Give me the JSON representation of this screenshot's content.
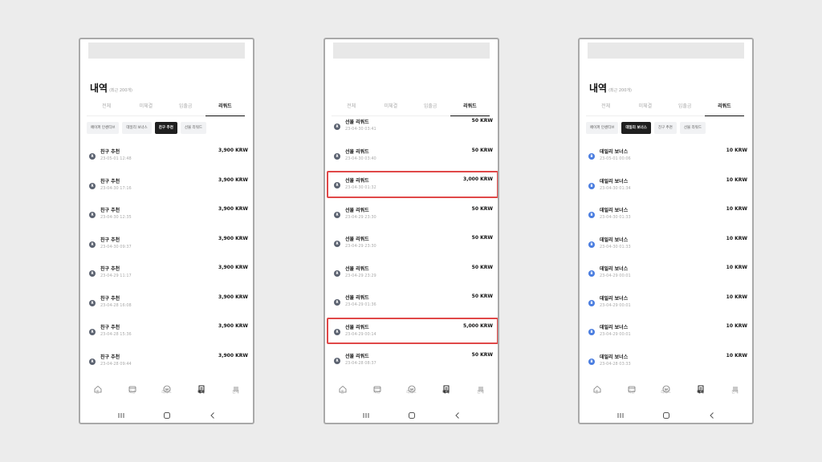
{
  "screens": [
    {
      "title": "내역",
      "subtitle": "(최근 200개)",
      "tabs": [
        "전체",
        "미체결",
        "입출금",
        "리워드"
      ],
      "active_tab": 3,
      "chips": [
        "페이퍼 인센티브",
        "데일리 보너스",
        "친구 추천",
        "선물 리워드"
      ],
      "active_chip": 2,
      "rows": [
        {
          "icon": "R",
          "title": "친구 추천",
          "time": "23-05-01 12:48",
          "amount": "3,900 KRW"
        },
        {
          "icon": "R",
          "title": "친구 추천",
          "time": "23-04-30 17:16",
          "amount": "3,900 KRW"
        },
        {
          "icon": "R",
          "title": "친구 추천",
          "time": "23-04-30 12:35",
          "amount": "3,900 KRW"
        },
        {
          "icon": "R",
          "title": "친구 추천",
          "time": "23-04-30 09:37",
          "amount": "3,900 KRW"
        },
        {
          "icon": "R",
          "title": "친구 추천",
          "time": "23-04-29 11:17",
          "amount": "3,900 KRW"
        },
        {
          "icon": "R",
          "title": "친구 추천",
          "time": "23-04-28 16:08",
          "amount": "3,900 KRW"
        },
        {
          "icon": "R",
          "title": "친구 추천",
          "time": "23-04-28 15:36",
          "amount": "3,900 KRW"
        },
        {
          "icon": "R",
          "title": "친구 추천",
          "time": "23-04-28 09:44",
          "amount": "3,900 KRW"
        }
      ]
    },
    {
      "tabs": [
        "전체",
        "미체결",
        "입출금",
        "리워드"
      ],
      "active_tab": 3,
      "rows": [
        {
          "icon": "R",
          "title": "선물 리워드",
          "time": "23-04-30 03:41",
          "amount": "50 KRW"
        },
        {
          "icon": "R",
          "title": "선물 리워드",
          "time": "23-04-30 03:40",
          "amount": "50 KRW"
        },
        {
          "icon": "R",
          "title": "선물 리워드",
          "time": "23-04-30 01:32",
          "amount": "3,000 KRW",
          "highlight": true
        },
        {
          "icon": "R",
          "title": "선물 리워드",
          "time": "23-04-29 23:30",
          "amount": "50 KRW"
        },
        {
          "icon": "R",
          "title": "선물 리워드",
          "time": "23-04-29 23:30",
          "amount": "50 KRW"
        },
        {
          "icon": "R",
          "title": "선물 리워드",
          "time": "23-04-29 23:29",
          "amount": "50 KRW"
        },
        {
          "icon": "R",
          "title": "선물 리워드",
          "time": "23-04-29 01:36",
          "amount": "50 KRW"
        },
        {
          "icon": "R",
          "title": "선물 리워드",
          "time": "23-04-29 00:14",
          "amount": "5,000 KRW",
          "highlight": true
        },
        {
          "icon": "R",
          "title": "선물 리워드",
          "time": "23-04-28 08:37",
          "amount": "50 KRW"
        }
      ]
    },
    {
      "title": "내역",
      "subtitle": "(최근 200개)",
      "tabs": [
        "전체",
        "미체결",
        "입출금",
        "리워드"
      ],
      "active_tab": 3,
      "chips": [
        "페이퍼 인센티브",
        "데일리 보너스",
        "친구 추천",
        "선물 리워드"
      ],
      "active_chip": 1,
      "rows": [
        {
          "icon": "B",
          "title": "데일리 보너스",
          "time": "23-05-01 00:06",
          "amount": "10 KRW"
        },
        {
          "icon": "B",
          "title": "데일리 보너스",
          "time": "23-04-30 01:34",
          "amount": "10 KRW"
        },
        {
          "icon": "B",
          "title": "데일리 보너스",
          "time": "23-04-30 01:33",
          "amount": "10 KRW"
        },
        {
          "icon": "B",
          "title": "데일리 보너스",
          "time": "23-04-30 01:33",
          "amount": "10 KRW"
        },
        {
          "icon": "B",
          "title": "데일리 보너스",
          "time": "23-04-29 00:01",
          "amount": "10 KRW"
        },
        {
          "icon": "B",
          "title": "데일리 보너스",
          "time": "23-04-29 00:01",
          "amount": "10 KRW"
        },
        {
          "icon": "B",
          "title": "데일리 보너스",
          "time": "23-04-29 00:01",
          "amount": "10 KRW"
        },
        {
          "icon": "B",
          "title": "데일리 보너스",
          "time": "23-04-28 03:33",
          "amount": "10 KRW"
        }
      ]
    }
  ],
  "nav": [
    "홈",
    "자산",
    "리워드",
    "내역",
    "전체"
  ],
  "nav_icons": [
    "home-icon",
    "wallet-icon",
    "reward-icon",
    "history-icon",
    "menu-icon"
  ],
  "nav_active": 3,
  "system_buttons": [
    "recent-apps-icon",
    "home-button-icon",
    "back-icon"
  ],
  "colors": {
    "highlight": "#e04848",
    "reward_badge": "#5b6270",
    "bonus_badge": "#4a7de0"
  }
}
